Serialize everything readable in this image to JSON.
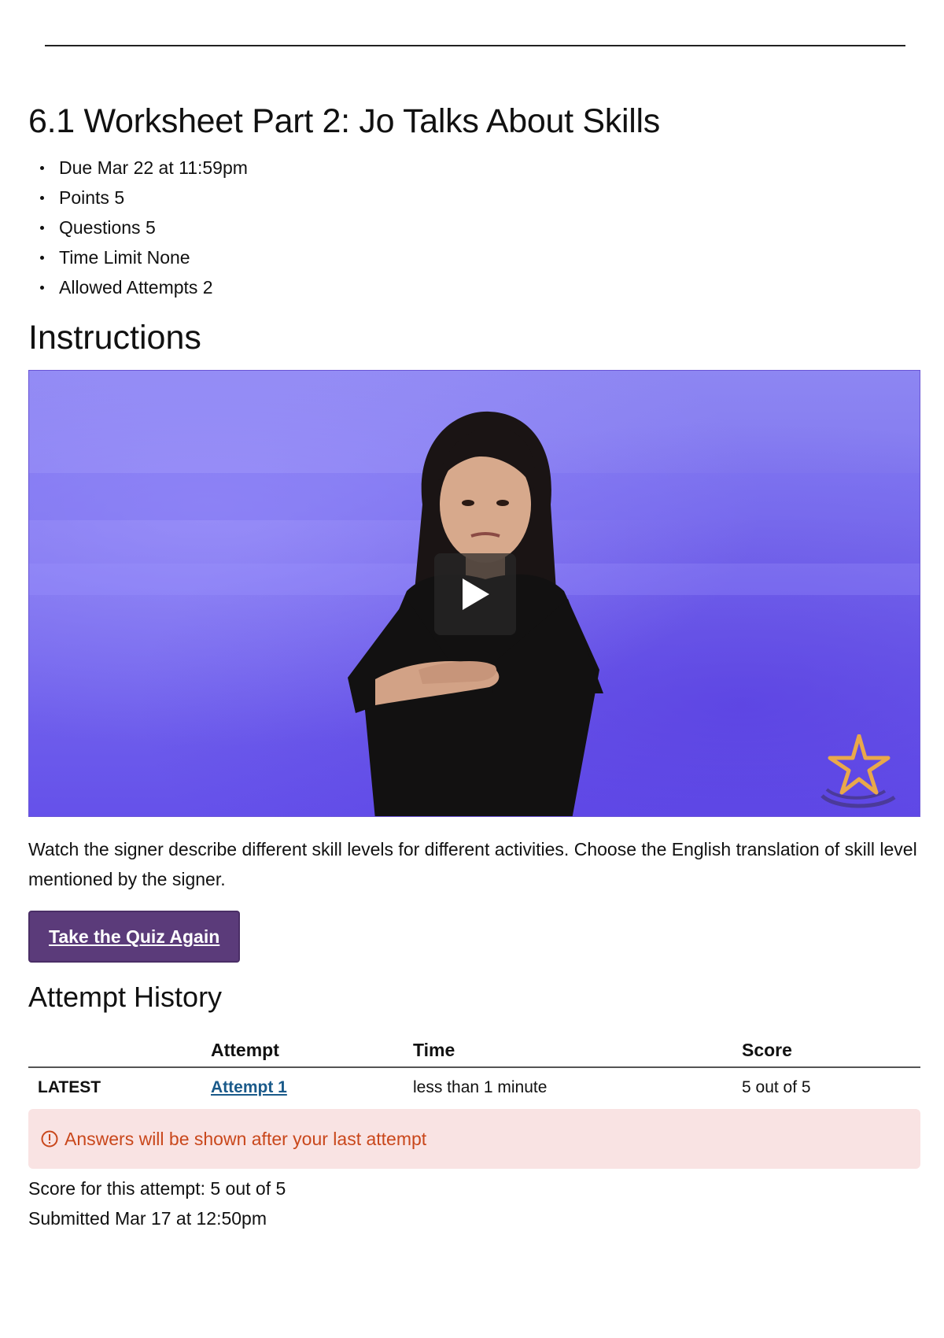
{
  "quiz": {
    "title": "6.1 Worksheet Part 2: Jo Talks About Skills",
    "meta": [
      "Due Mar 22 at 11:59pm",
      "Points 5",
      "Questions 5",
      "Time Limit None",
      "Allowed Attempts 2"
    ]
  },
  "instructions": {
    "heading": "Instructions",
    "text": "Watch the signer describe different skill levels for different activities. Choose the English translation of skill level mentioned by the signer."
  },
  "video": {
    "play_icon": "play-icon",
    "logo_icon": "star-logo-icon",
    "accent_color": "#7b70ee"
  },
  "actions": {
    "take_again_label": "Take the Quiz Again",
    "button_color": "#5b3b7a"
  },
  "history": {
    "heading": "Attempt History",
    "columns": [
      "",
      "Attempt",
      "Time",
      "Score"
    ],
    "rows": [
      {
        "tag": "LATEST",
        "attempt": "Attempt 1",
        "time": "less than 1 minute",
        "score": "5 out of 5"
      }
    ]
  },
  "alert": {
    "icon": "alert-circle-icon",
    "text": "Answers will be shown after your last attempt",
    "color": "#c9471b"
  },
  "result": {
    "score_line": "Score for this attempt: 5 out of 5",
    "submitted_line": "Submitted Mar 17 at 12:50pm"
  }
}
